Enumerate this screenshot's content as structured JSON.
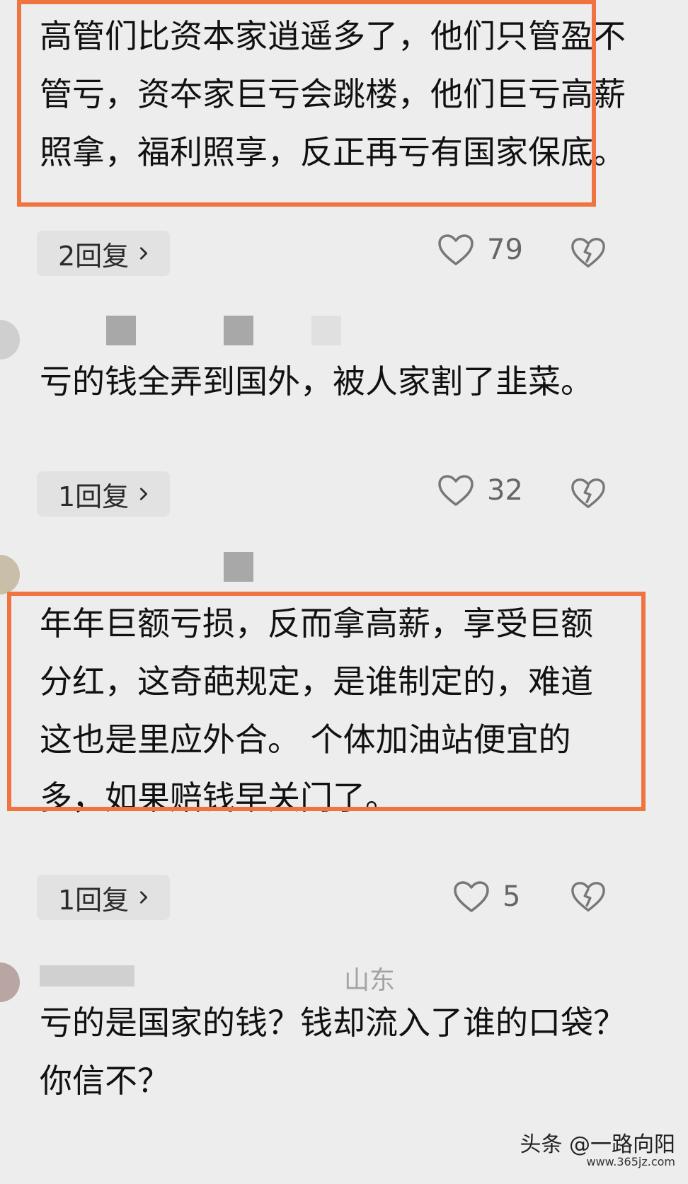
{
  "comments": [
    {
      "text": "高管们比资本家逍遥多了，他们只管盈不管亏，资夲家巨亏会跳楼，他们巨亏高薪照拿，福利照享，反正再亏有国家保底。",
      "reply_label": "2回复",
      "like_count": "79"
    },
    {
      "text": "亏的钱全弄到国外，被人家割了韭菜。",
      "reply_label": "1回复",
      "like_count": "32"
    },
    {
      "text": "年年巨额亏损，反而拿高薪，享受巨额分红，这奇葩规定，是谁制定的，难道这也是里应外合。 个体加油站便宜的多，如果赔钱早关门了。",
      "reply_label": "1回复",
      "like_count": "5"
    },
    {
      "text": "亏的是国家的钱？钱却流入了谁的口袋？你信不？",
      "location": "山东"
    }
  ],
  "watermark": {
    "main": "头条 @一路向阳",
    "sub": "www.365jz.com"
  },
  "icons": {
    "like": "heart-outline-icon",
    "dislike": "broken-heart-icon",
    "chevron": "chevron-right-icon"
  },
  "colors": {
    "background": "#ededed",
    "highlight": "#f0743f"
  }
}
